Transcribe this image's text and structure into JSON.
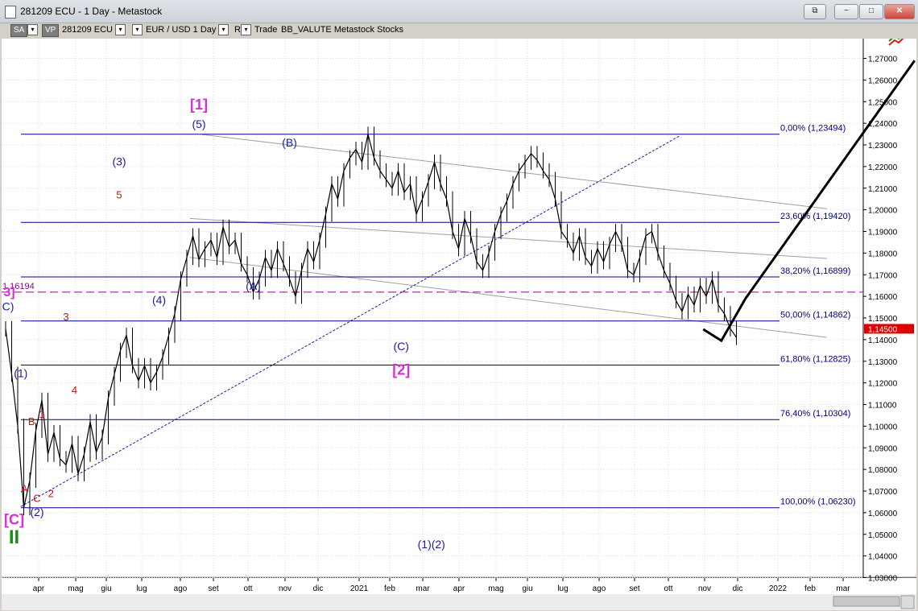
{
  "window": {
    "title": "281209 ECU - 1 Day - Metastock",
    "buttons": [
      "⧉",
      "−",
      "□",
      "✕"
    ]
  },
  "toolbar": {
    "sa": "SA",
    "vp": "VP",
    "symbol": "281209 ECU",
    "instrument": "EUR / USD  1 Day",
    "r": "R",
    "trade": "Trade",
    "template": "BB_VALUTE  Metastock  Stocks",
    "arrow_down": "▾"
  },
  "colors": {
    "price": "#000000",
    "grid": "#dcdcdc",
    "fib_line": "#00008b",
    "channel": "#a0a0a0",
    "wave_blue": "#1a1aa8",
    "wave_red": "#cc1111",
    "wave_magenta": "#d62fd6",
    "wave_green": "#1a8a1a",
    "current_price_bg": "#e00000"
  },
  "chart_data": {
    "type": "line",
    "x_ticks": [
      "apr",
      "mag",
      "giu",
      "lug",
      "ago",
      "set",
      "ott",
      "nov",
      "dic",
      "2021",
      "feb",
      "mar",
      "apr",
      "mag",
      "giu",
      "lug",
      "ago",
      "set",
      "ott",
      "nov",
      "dic",
      "2022",
      "feb",
      "mar"
    ],
    "y_ticks": [
      "1,27000",
      "1,26000",
      "1,25000",
      "1,24000",
      "1,23000",
      "1,22000",
      "1,21000",
      "1,20000",
      "1,19000",
      "1,18000",
      "1,17000",
      "1,16000",
      "1,15000",
      "1,14000",
      "1,13000",
      "1,12000",
      "1,11000",
      "1,10000",
      "1,09000",
      "1,08000",
      "1,07000",
      "1,06000",
      "1,05000",
      "1,04000",
      "1,03000"
    ],
    "ylim": [
      1.03,
      1.27
    ],
    "series": [
      {
        "values": [
          1.145,
          1.124,
          1.1,
          1.0623,
          1.075,
          1.098,
          1.112,
          1.087,
          1.097,
          1.085,
          1.082,
          1.092,
          1.078,
          1.087,
          1.102,
          1.088,
          1.095,
          1.113,
          1.124,
          1.135,
          1.142,
          1.128,
          1.121,
          1.128,
          1.12,
          1.125,
          1.132,
          1.142,
          1.152,
          1.168,
          1.178,
          1.188,
          1.177,
          1.182,
          1.186,
          1.178,
          1.192,
          1.183,
          1.186,
          1.175,
          1.17,
          1.162,
          1.168,
          1.178,
          1.172,
          1.182,
          1.175,
          1.168,
          1.16,
          1.172,
          1.182,
          1.176,
          1.186,
          1.198,
          1.212,
          1.205,
          1.218,
          1.224,
          1.228,
          1.222,
          1.2349,
          1.224,
          1.218,
          1.214,
          1.21,
          1.218,
          1.208,
          1.212,
          1.198,
          1.205,
          1.213,
          1.222,
          1.212,
          1.205,
          1.19,
          1.182,
          1.196,
          1.188,
          1.176,
          1.172,
          1.18,
          1.19,
          1.198,
          1.204,
          1.212,
          1.218,
          1.222,
          1.226,
          1.223,
          1.218,
          1.214,
          1.205,
          1.19,
          1.186,
          1.18,
          1.188,
          1.178,
          1.174,
          1.182,
          1.176,
          1.184,
          1.19,
          1.184,
          1.172,
          1.17,
          1.178,
          1.188,
          1.19,
          1.18,
          1.172,
          1.166,
          1.158,
          1.153,
          1.161,
          1.156,
          1.165,
          1.16,
          1.168,
          1.156,
          1.152,
          1.145,
          1.141
        ]
      }
    ],
    "fib_levels": [
      {
        "label": "0,00% (1,23494)",
        "value": 1.23494
      },
      {
        "label": "23,60% (1,19420)",
        "value": 1.1942
      },
      {
        "label": "38,20% (1,16899)",
        "value": 1.16899
      },
      {
        "label": "50,00% (1,14862)",
        "value": 1.14862
      },
      {
        "label": "61,80% (1,12825)",
        "value": 1.12825
      },
      {
        "label": "76,40% (1,10304)",
        "value": 1.10304
      },
      {
        "label": "100,00% (1,06230)",
        "value": 1.0623
      }
    ],
    "dashed_level": {
      "label": "1,16194",
      "value": 1.16194
    },
    "current_price": "1,14500",
    "projection": [
      [
        115.5,
        1.1448
      ],
      [
        118.5,
        1.1395
      ],
      [
        122.5,
        1.159
      ],
      [
        150.5,
        1.269
      ]
    ],
    "trendline": [
      [
        2.5,
        1.0628
      ],
      [
        111.5,
        1.234
      ]
    ],
    "channels": [
      [
        [
          32.5,
          1.2348
        ],
        [
          136,
          1.2005
        ]
      ],
      [
        [
          30.5,
          1.196
        ],
        [
          136,
          1.1775
        ]
      ],
      [
        [
          30.5,
          1.178
        ],
        [
          136,
          1.141
        ]
      ]
    ],
    "wave_labels": [
      {
        "text": "[1]",
        "x": 32,
        "y": 1.2464,
        "color": "magenta",
        "size": 18
      },
      {
        "text": "(5)",
        "x": 32,
        "y": 1.2378,
        "color": "blue",
        "size": 14
      },
      {
        "text": "(B)",
        "x": 47,
        "y": 1.2293,
        "color": "blue",
        "size": 14
      },
      {
        "text": "(3)",
        "x": 18.8,
        "y": 1.2205,
        "color": "blue",
        "size": 14
      },
      {
        "text": "5",
        "x": 18.8,
        "y": 1.2052,
        "color": "red",
        "size": 13
      },
      {
        "text": "(4)",
        "x": 25.4,
        "y": 1.1566,
        "color": "blue",
        "size": 14
      },
      {
        "text": "(A)",
        "x": 41,
        "y": 1.1631,
        "color": "blue",
        "size": 14
      },
      {
        "text": "(C)",
        "x": 65.5,
        "y": 1.1351,
        "color": "blue",
        "size": 14
      },
      {
        "text": "[2]",
        "x": 65.5,
        "y": 1.1237,
        "color": "magenta",
        "size": 18
      },
      {
        "text": "3",
        "x": 10,
        "y": 1.1488,
        "color": "red",
        "size": 13
      },
      {
        "text": "4",
        "x": 11.4,
        "y": 1.1151,
        "color": "red",
        "size": 13
      },
      {
        "text": "(1)",
        "x": 2.5,
        "y": 1.1226,
        "color": "blue",
        "size": 14
      },
      {
        "text": "B",
        "x": 4.3,
        "y": 1.1005,
        "color": "red",
        "size": 13
      },
      {
        "text": "1",
        "x": 6,
        "y": 1.1039,
        "color": "red",
        "size": 13
      },
      {
        "text": "A",
        "x": 3.1,
        "y": 1.0695,
        "color": "red",
        "size": 13
      },
      {
        "text": "C",
        "x": 5.2,
        "y": 1.065,
        "color": "red",
        "size": 13
      },
      {
        "text": "2",
        "x": 7.5,
        "y": 1.0672,
        "color": "red",
        "size": 13
      },
      {
        "text": "(2)",
        "x": 5.2,
        "y": 1.0584,
        "color": "blue",
        "size": 14
      },
      {
        "text": "[C]",
        "x": 1.4,
        "y": 1.0546,
        "color": "magenta",
        "size": 18
      },
      {
        "text": "II",
        "x": 1.4,
        "y": 1.0459,
        "color": "green",
        "size": 24
      },
      {
        "text": "(1)(2)",
        "x": 70.5,
        "y": 1.0436,
        "color": "blue",
        "size": 14
      },
      {
        "text": "C)",
        "x": 0.4,
        "y": 1.1535,
        "color": "blue",
        "size": 14
      },
      {
        "text": "3]",
        "x": 0.6,
        "y": 1.1601,
        "color": "magenta",
        "size": 16
      }
    ]
  }
}
